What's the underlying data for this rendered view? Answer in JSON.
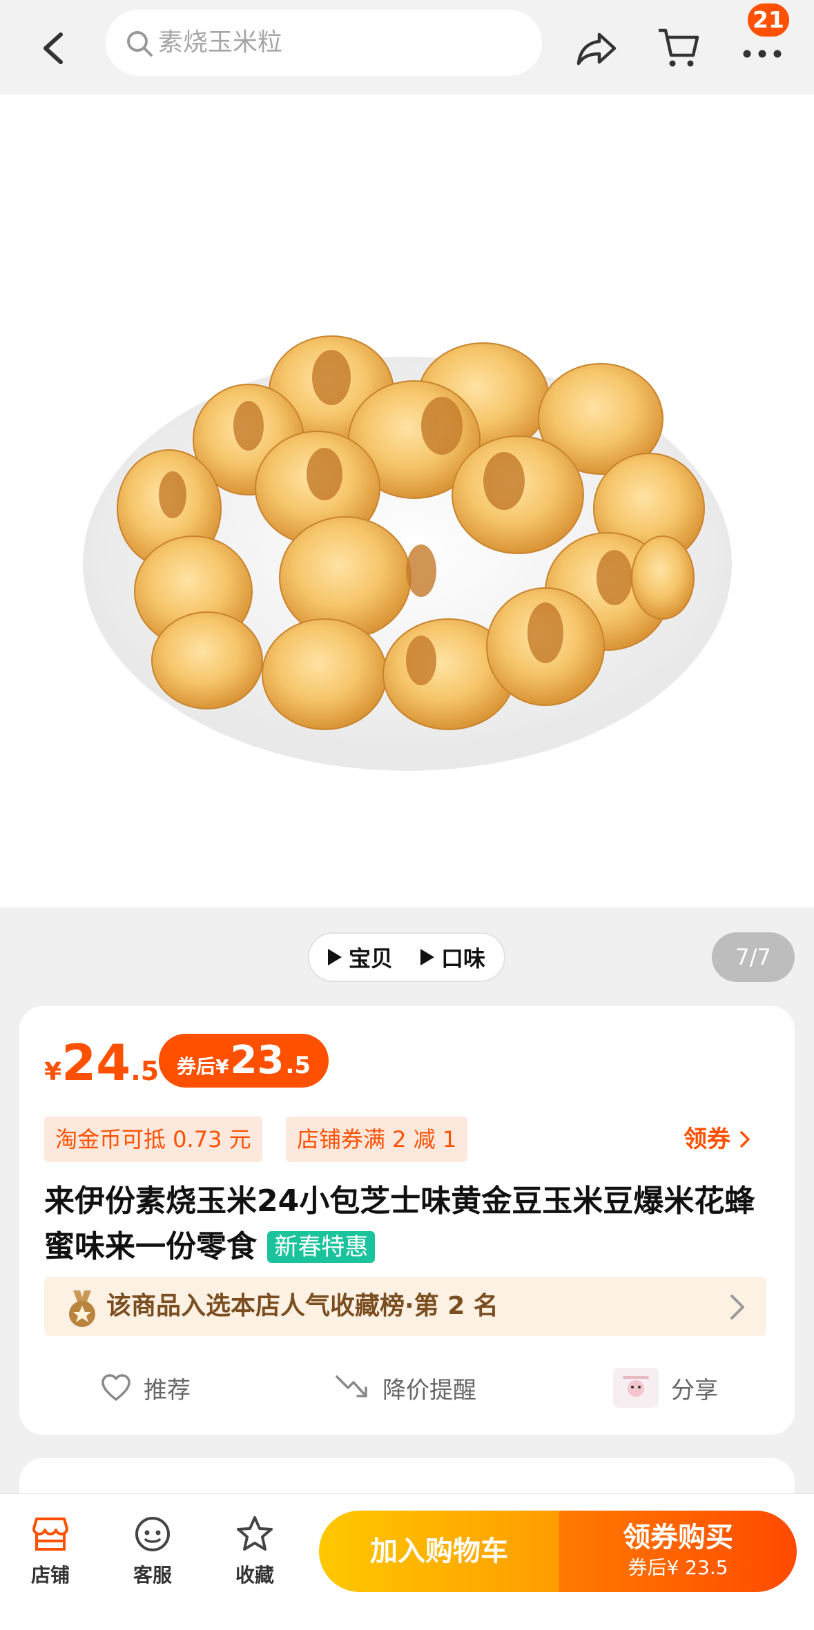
{
  "header": {
    "search_placeholder": "素烧玉米粒",
    "badge_count": "21"
  },
  "gallery": {
    "video_tabs": [
      "宝贝",
      "口味"
    ],
    "page_indicator": "7/7"
  },
  "price": {
    "currency": "¥",
    "integer": "24",
    "decimal": ".5",
    "after_coupon_label": "券后¥",
    "after_coupon_integer": "23",
    "after_coupon_decimal": ".5"
  },
  "tags": {
    "coin": "淘金币可抵 0.73 元",
    "shop_coupon": "店铺券满 2 减 1",
    "get_coupon": "领券"
  },
  "product": {
    "title": "来伊份素烧玉米24小包芝士味黄金豆玉米豆爆米花蜂蜜味来一份零食",
    "promo_badge": "新春特惠",
    "rank_text": "该商品入选本店人气收藏榜·第 2 名"
  },
  "actions": {
    "recommend": "推荐",
    "price_alert": "降价提醒",
    "share": "分享"
  },
  "bottom_bar": {
    "shop": "店铺",
    "service": "客服",
    "favorite": "收藏",
    "add_to_cart": "加入购物车",
    "buy_label": "领券购买",
    "buy_sub": "券后¥ 23.5"
  },
  "colors": {
    "accent": "#ff5000",
    "promo_green": "#1bc39d",
    "cart_yellow": "#ffc800"
  }
}
